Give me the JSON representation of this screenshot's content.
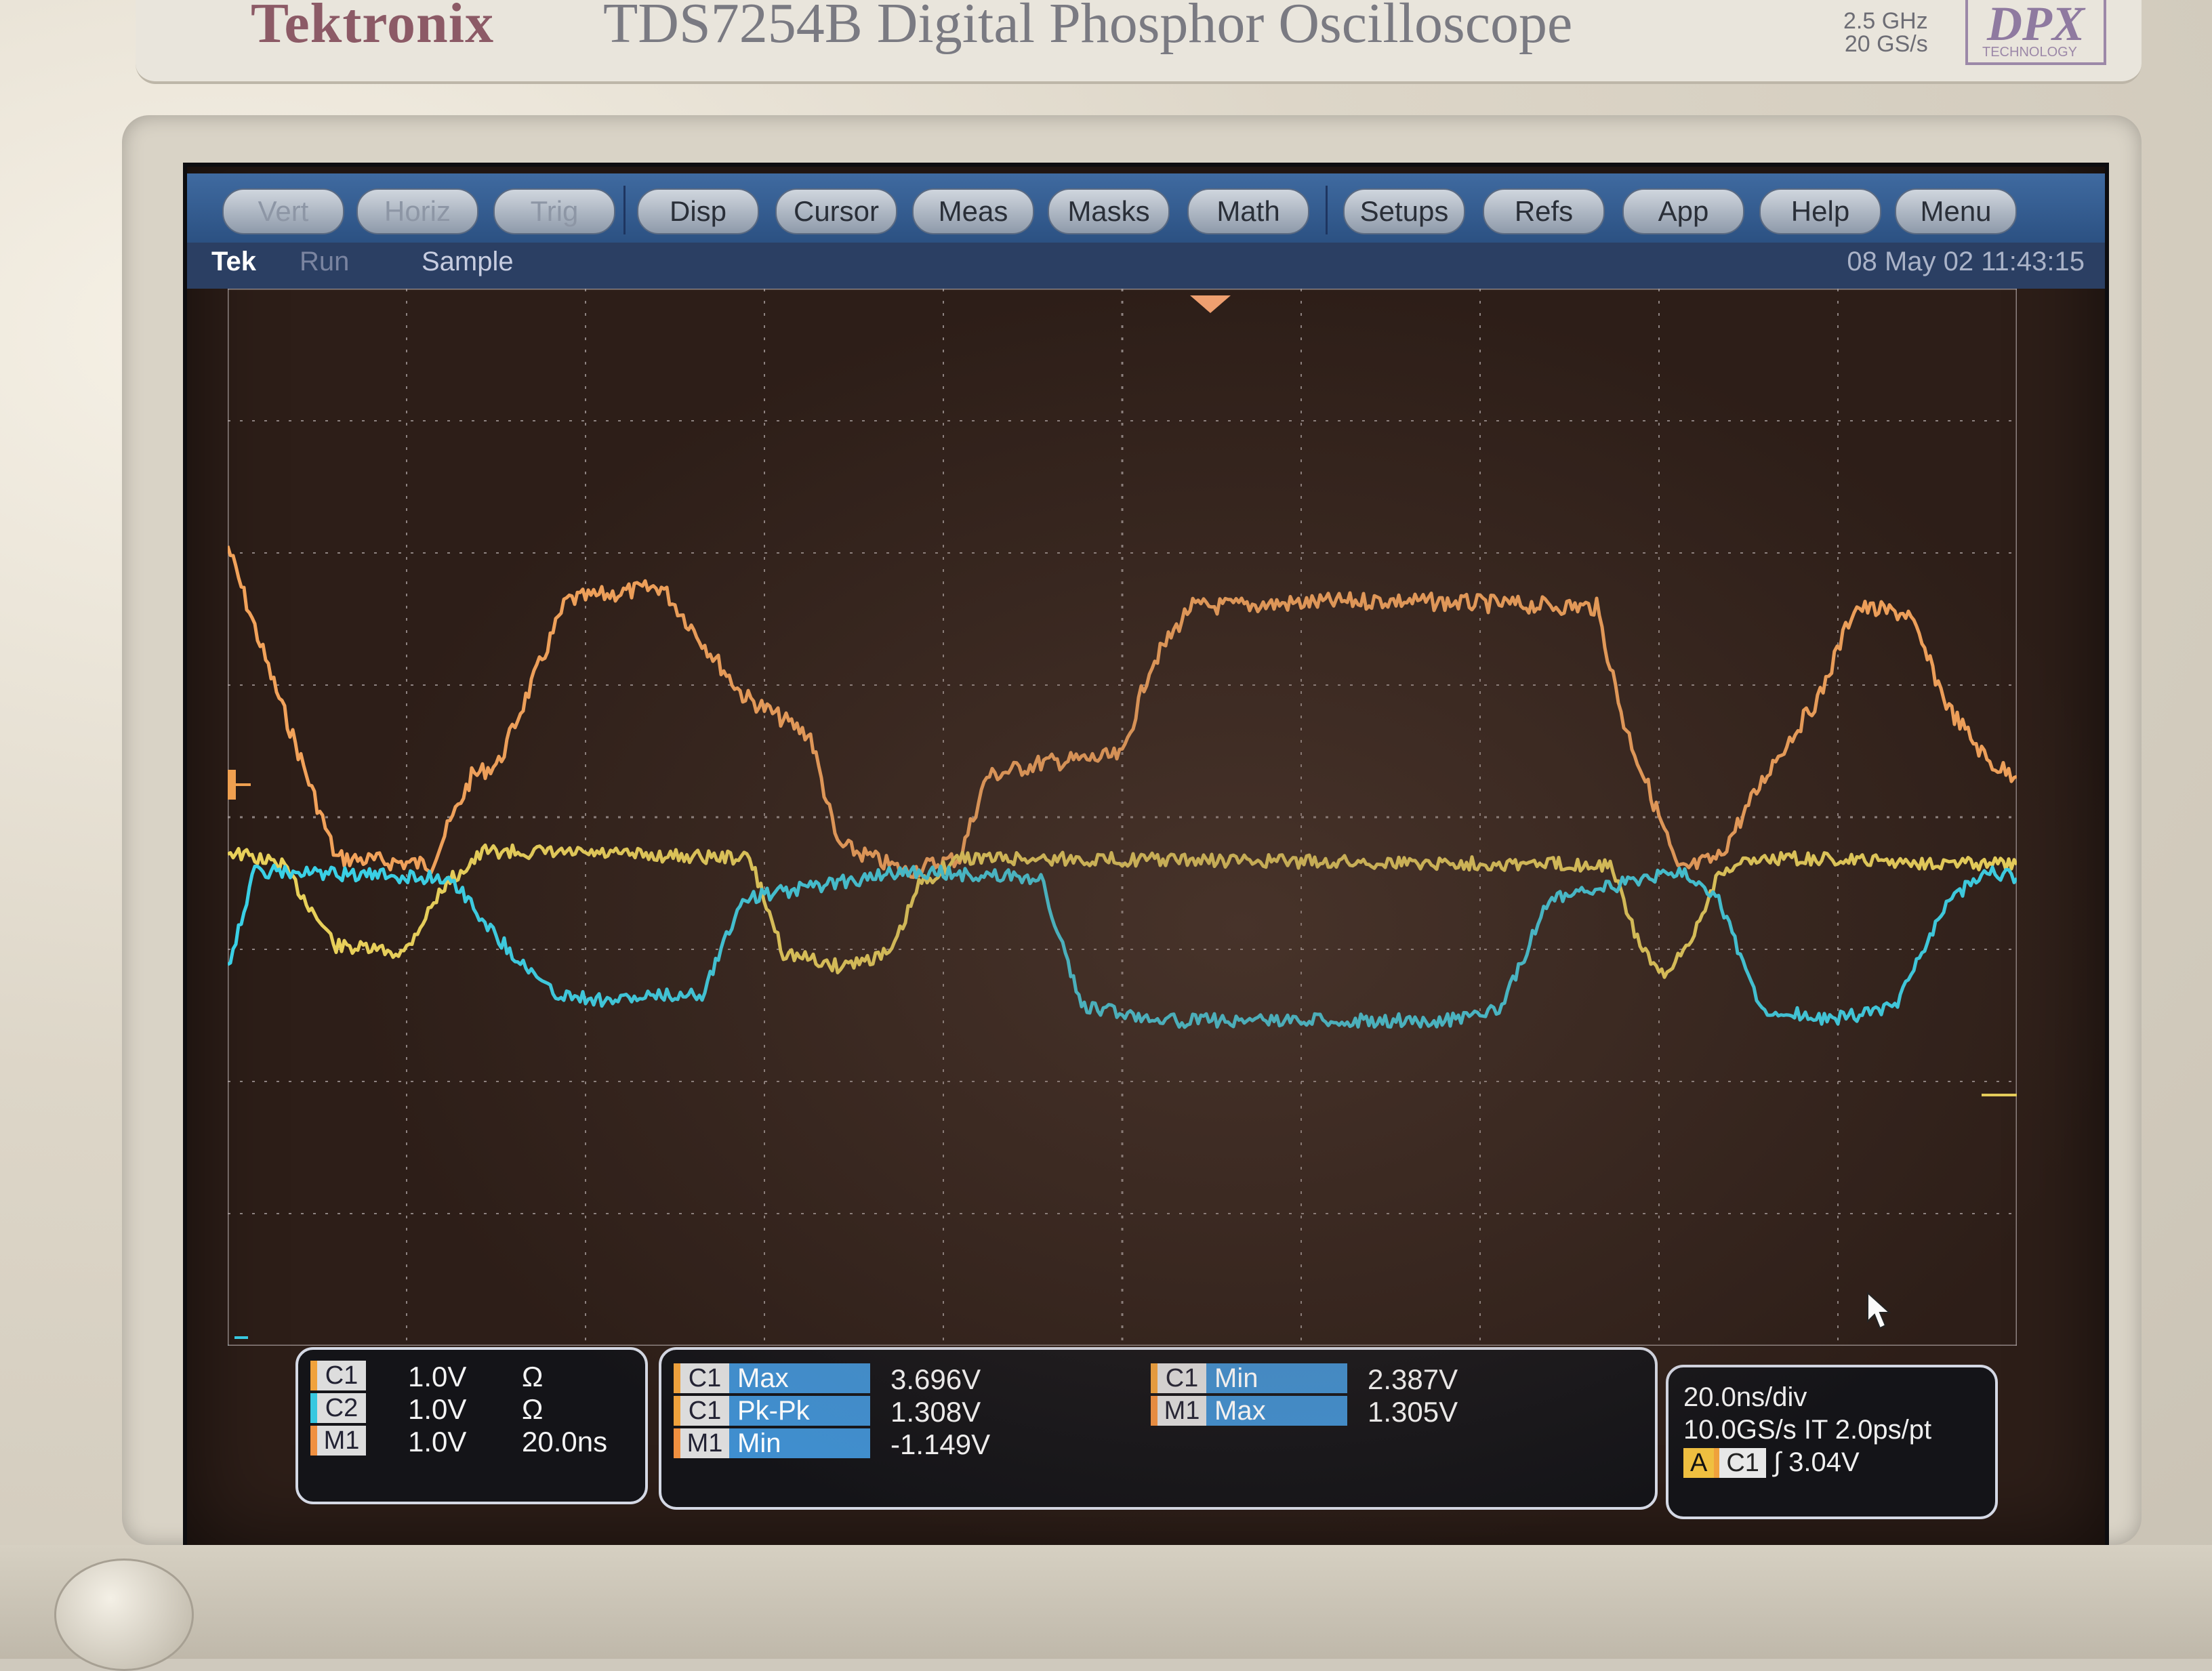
{
  "instrument": {
    "brand": "Tektronix",
    "model": "TDS7254B",
    "description": "Digital Phosphor Oscilloscope",
    "spec_bandwidth": "2.5 GHz",
    "spec_sample_rate": "20 GS/s",
    "badge": "DPX",
    "badge_sub": "TECHNOLOGY"
  },
  "menu": {
    "items": [
      {
        "label": "Vert",
        "dim": true
      },
      {
        "label": "Horiz",
        "dim": true
      },
      {
        "label": "Trig",
        "dim": true
      },
      {
        "label": "Disp",
        "dim": false
      },
      {
        "label": "Cursor",
        "dim": false
      },
      {
        "label": "Meas",
        "dim": false
      },
      {
        "label": "Masks",
        "dim": false
      },
      {
        "label": "Math",
        "dim": false
      },
      {
        "label": "Setups",
        "dim": false
      },
      {
        "label": "Refs",
        "dim": false
      },
      {
        "label": "App",
        "dim": false
      },
      {
        "label": "Help",
        "dim": false
      },
      {
        "label": "Menu",
        "dim": false
      }
    ]
  },
  "status": {
    "brand_short": "Tek",
    "run_state": "Run",
    "acq_mode": "Sample",
    "datetime": "08 May 02 11:43:15"
  },
  "markers": {
    "m1": "M1",
    "ch2": "2"
  },
  "colors": {
    "ch1_trace": "#f2a25a",
    "ch2_trace": "#3ad0e6",
    "yellow_trace": "#e8d05a",
    "grid": "#b8aeae",
    "screen_bg": "#2d1e18"
  },
  "channels": [
    {
      "id": "C1",
      "scale": "1.0V",
      "coupling": "Ω",
      "color": "#f0a23c"
    },
    {
      "id": "C2",
      "scale": "1.0V",
      "coupling": "Ω",
      "color": "#38c8e0"
    },
    {
      "id": "M1",
      "scale": "1.0V",
      "coupling": "20.0ns",
      "color": "#f09040"
    }
  ],
  "measurements_left": [
    {
      "source": "C1",
      "name": "Max",
      "value": "3.696V"
    },
    {
      "source": "C1",
      "name": "Pk-Pk",
      "value": "1.308V"
    },
    {
      "source": "M1",
      "name": "Min",
      "value": "-1.149V"
    }
  ],
  "measurements_right": [
    {
      "source": "C1",
      "name": "Min",
      "value": "2.387V"
    },
    {
      "source": "M1",
      "name": "Max",
      "value": "1.305V"
    }
  ],
  "timebase": {
    "scale": "20.0ns/div",
    "sample": "10.0GS/s IT 2.0ps/pt",
    "trigger_mode": "A",
    "trigger_source": "C1",
    "trigger_slope": "∫",
    "trigger_level": "3.04V"
  }
}
